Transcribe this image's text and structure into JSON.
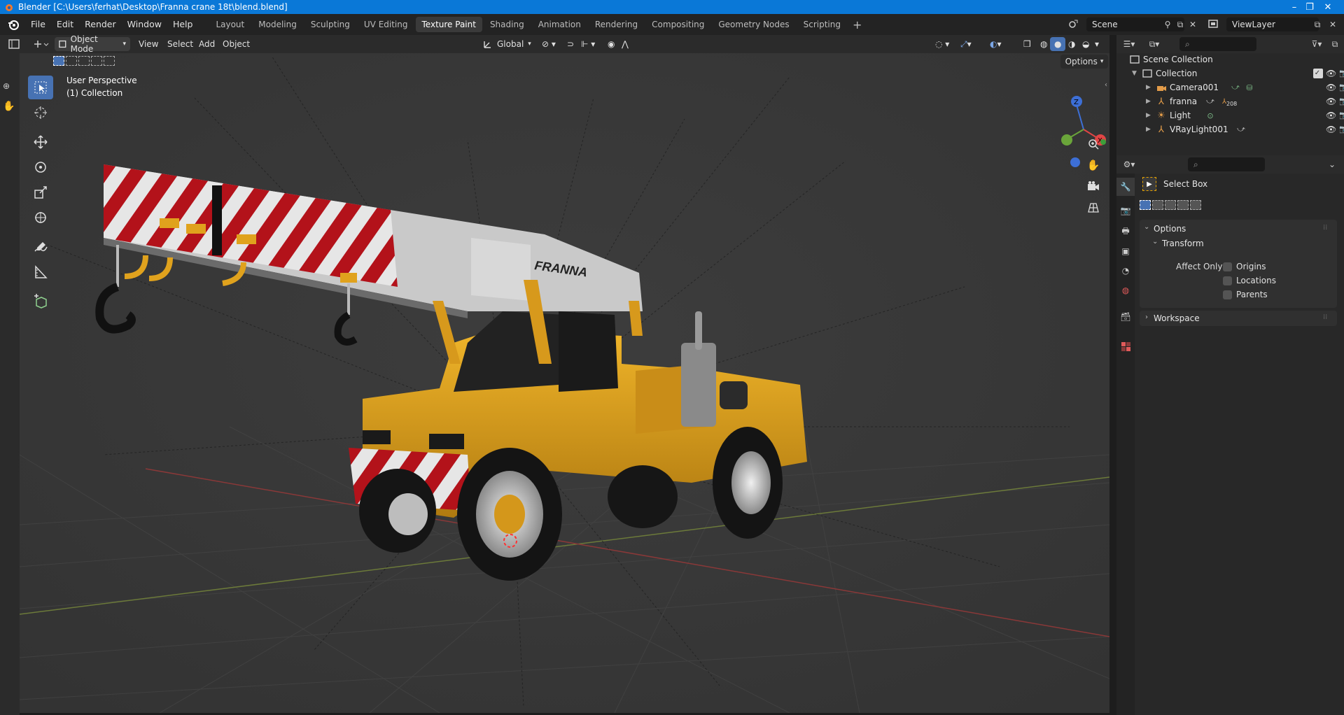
{
  "window": {
    "title": "Blender [C:\\Users\\ferhat\\Desktop\\Franna crane 18t\\blend.blend]",
    "controls": [
      "–",
      "❐",
      "✕"
    ]
  },
  "menu": [
    "File",
    "Edit",
    "Render",
    "Window",
    "Help"
  ],
  "workspaces": [
    "Layout",
    "Modeling",
    "Sculpting",
    "UV Editing",
    "Texture Paint",
    "Shading",
    "Animation",
    "Rendering",
    "Compositing",
    "Geometry Nodes",
    "Scripting"
  ],
  "active_workspace": "Texture Paint",
  "scene": {
    "name": "Scene",
    "view_layer": "ViewLayer"
  },
  "viewport": {
    "mode": "Object Mode",
    "menus": [
      "View",
      "Select",
      "Add",
      "Object"
    ],
    "orientation": "Global",
    "overlay_line1": "User Perspective",
    "overlay_line2": "(1) Collection",
    "options_label": "Options",
    "gizmo": {
      "z": "Z",
      "x": "X"
    },
    "boom_brand": "FRANNA"
  },
  "outliner": {
    "scene_collection": "Scene Collection",
    "collection": "Collection",
    "items": [
      {
        "name": "Camera001",
        "icon": "camera-object-icon"
      },
      {
        "name": "franna",
        "icon": "armature-icon",
        "badge": "208"
      },
      {
        "name": "Light",
        "icon": "light-icon"
      },
      {
        "name": "VRayLight001",
        "icon": "armature-icon"
      }
    ]
  },
  "properties": {
    "tool_name": "Select Box",
    "options_panel": "Options",
    "transform_panel": "Transform",
    "affect_only_label": "Affect Only",
    "affect_only": [
      "Origins",
      "Locations",
      "Parents"
    ],
    "workspace_panel": "Workspace"
  },
  "colors": {
    "accent": "#4772b3",
    "titlebar": "#0a78d7",
    "viewport_bg": "#393939",
    "crane_yellow": "#e0a21d",
    "stripe_red": "#b3121a"
  }
}
